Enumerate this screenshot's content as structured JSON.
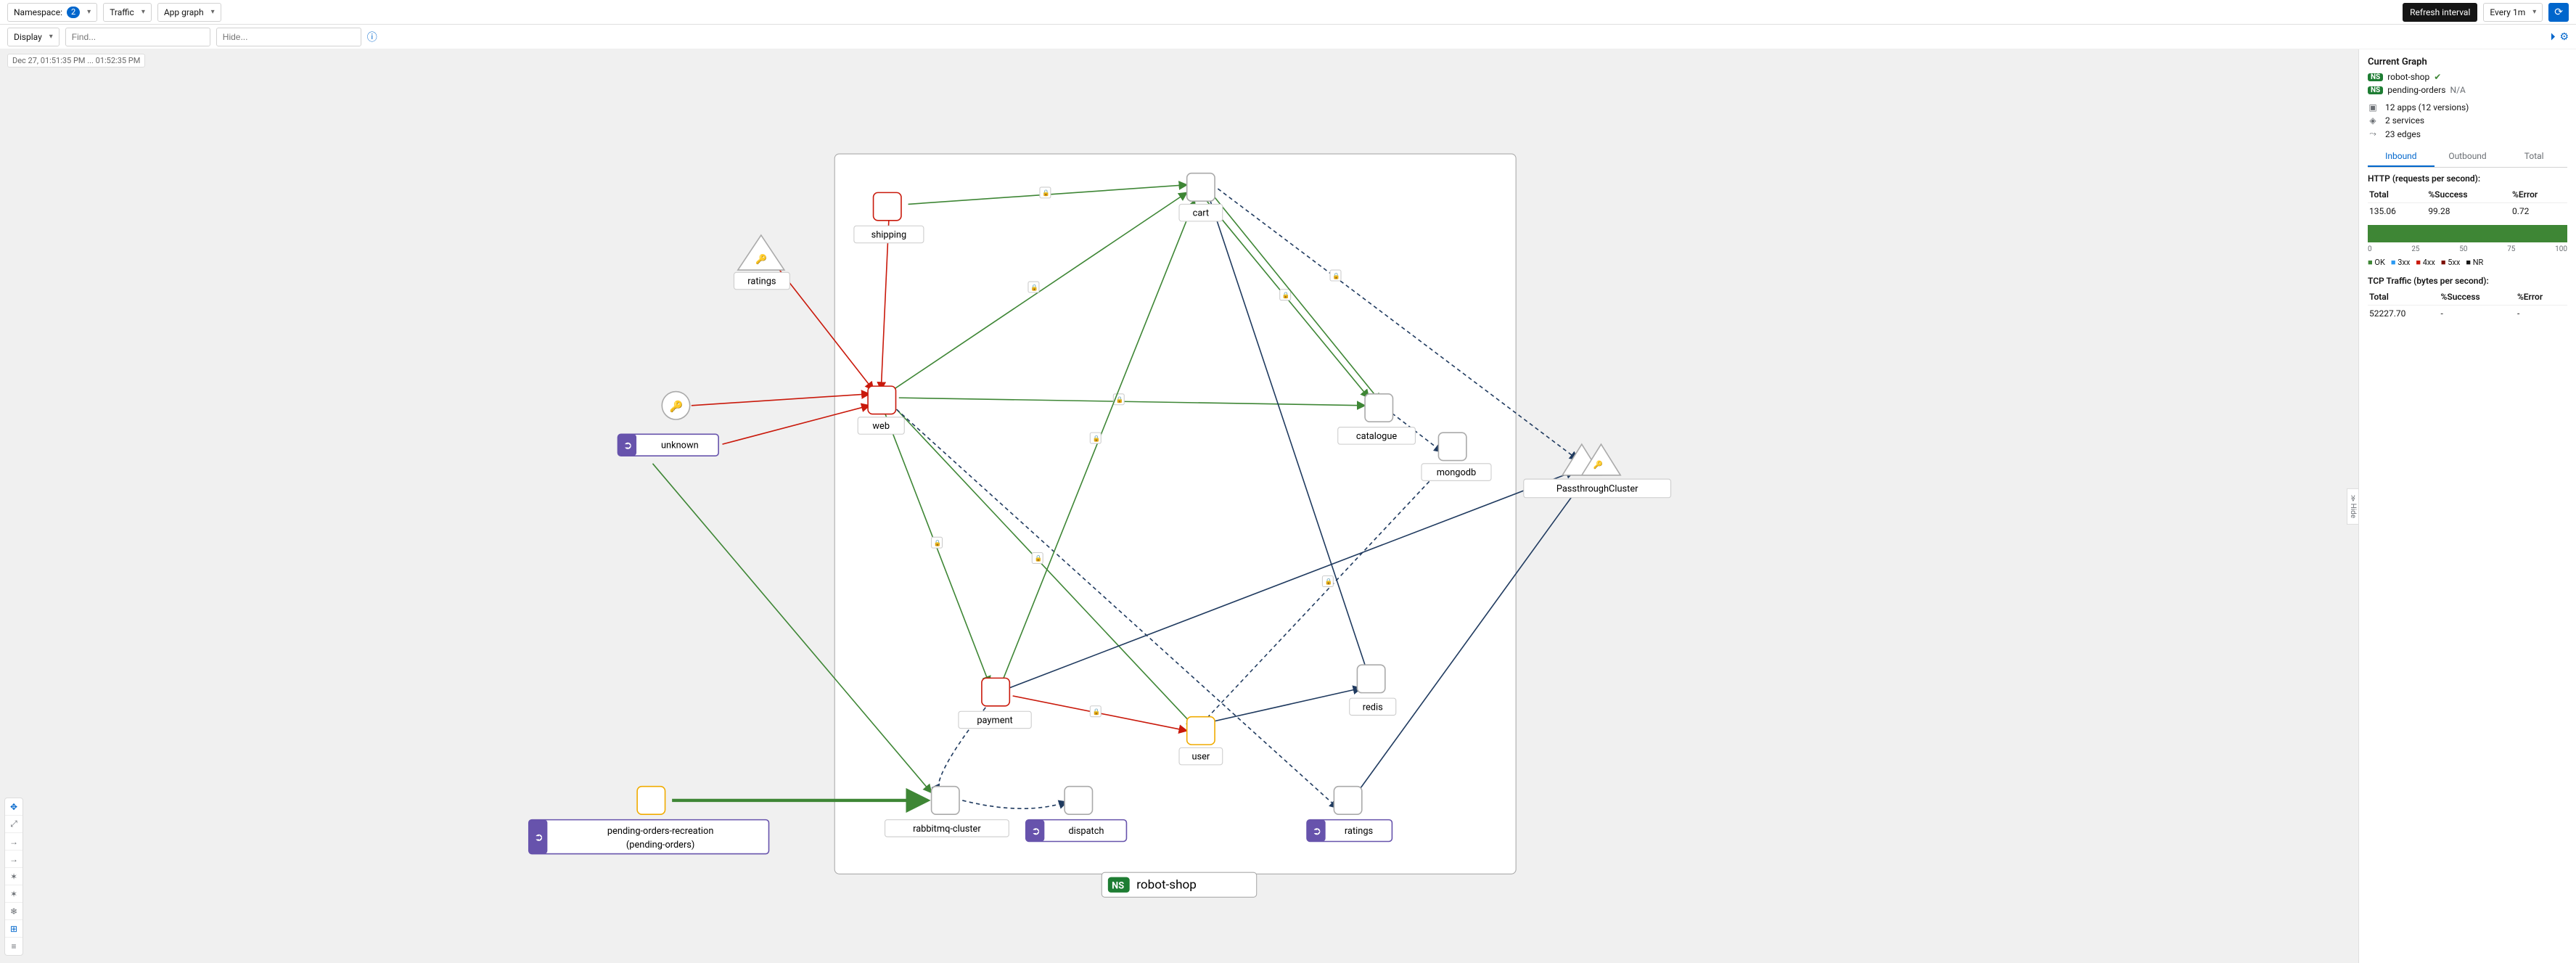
{
  "toolbar": {
    "namespace_label": "Namespace:",
    "namespace_count": "2",
    "traffic_label": "Traffic",
    "graph_type_label": "App graph",
    "refresh_interval_label": "Refresh interval",
    "every_label": "Every 1m",
    "display_label": "Display",
    "find_placeholder": "Find...",
    "hide_placeholder": "Hide..."
  },
  "timestamp": "Dec 27, 01:51:35 PM ... 01:52:35 PM",
  "namespace_label_main": "robot-shop",
  "nodes": {
    "shipping": "shipping",
    "ratings_tri": "ratings",
    "unknown_circle_icon": "🔑",
    "unknown_gateway": "unknown",
    "web": "web",
    "cart": "cart",
    "catalogue": "catalogue",
    "mongodb": "mongodb",
    "passthrough": "PassthroughCluster",
    "payment": "payment",
    "user": "user",
    "redis": "redis",
    "rabbitmq": "rabbitmq-cluster",
    "dispatch": "dispatch",
    "ratings_gw": "ratings",
    "pending_orders": "pending-orders-recreation",
    "pending_orders_sub": "(pending-orders)"
  },
  "side": {
    "title": "Current Graph",
    "ns1": "robot-shop",
    "ns2": "pending-orders",
    "ns2_status": "N/A",
    "summary_apps": "12 apps (12 versions)",
    "summary_services": "2 services",
    "summary_edges": "23 edges",
    "tabs": {
      "inbound": "Inbound",
      "outbound": "Outbound",
      "total": "Total"
    },
    "http_section": "HTTP (requests per second):",
    "tcp_section": "TCP Traffic (bytes per second):",
    "table_headers": {
      "total": "Total",
      "success": "%Success",
      "error": "%Error"
    },
    "http_row": {
      "total": "135.06",
      "success": "99.28",
      "error": "0.72"
    },
    "tcp_row": {
      "total": "52227.70",
      "success": "-",
      "error": "-"
    },
    "ticks": [
      "0",
      "25",
      "50",
      "75",
      "100"
    ],
    "legend": {
      "ok": "OK",
      "c3xx": "3xx",
      "c4xx": "4xx",
      "c5xx": "5xx",
      "nr": "NR"
    }
  },
  "hide_label": "Hide"
}
